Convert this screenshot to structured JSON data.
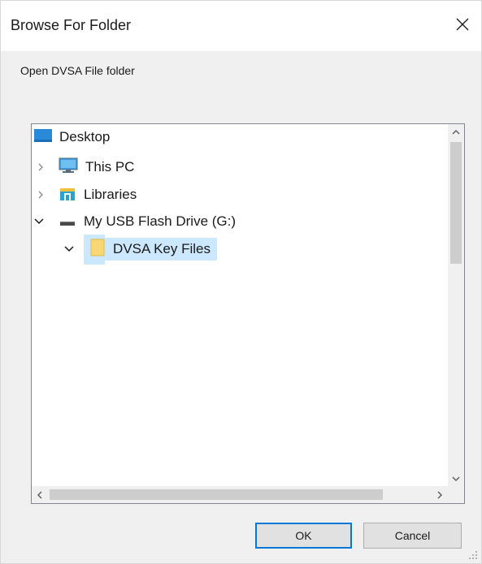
{
  "window": {
    "title": "Browse For Folder",
    "close_icon": "close-icon"
  },
  "prompt": "Open DVSA File folder",
  "tree": {
    "items": [
      {
        "label": "Desktop",
        "icon": "desktop-icon",
        "expander": "none",
        "level": 0
      },
      {
        "label": "This PC",
        "icon": "computer-icon",
        "expander": "collapsed",
        "level": 1
      },
      {
        "label": "Libraries",
        "icon": "libraries-icon",
        "expander": "collapsed",
        "level": 1
      },
      {
        "label": "My USB Flash Drive (G:)",
        "icon": "usb-drive-icon",
        "expander": "expanded",
        "level": 1
      },
      {
        "label": "DVSA Key Files",
        "icon": "folder-icon",
        "expander": "expanded",
        "level": 2,
        "selected": true
      }
    ]
  },
  "buttons": {
    "ok": "OK",
    "cancel": "Cancel"
  },
  "colors": {
    "selection": "#cce8ff",
    "default_button_border": "#0078d7",
    "folder": "#f8d775",
    "desktop": "#2b8ad8"
  }
}
